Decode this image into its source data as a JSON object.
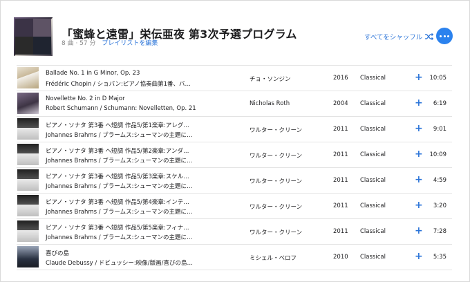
{
  "playlist": {
    "title": "「蜜蜂と遠雷」栄伝亜夜 第3次予選プログラム",
    "count": "8 曲 · 57 分",
    "edit_label": "プレイリストを編集",
    "shuffle_label": "すべてをシャッフル",
    "accent_color": "#2b74d8"
  },
  "tracks": [
    {
      "title": "Ballade No. 1 in G Minor, Op. 23",
      "sub": "Frédéric Chopin / ショパン:ピアノ協奏曲第1番、バ…",
      "artist": "チョ・ソンジン",
      "year": "2016",
      "genre": "Classical",
      "duration": "10:05"
    },
    {
      "title": "Novellette No. 2 in D Major",
      "sub": "Robert Schumann / Schumann: Novelletten, Op. 21",
      "artist": "Nicholas Roth",
      "year": "2004",
      "genre": "Classical",
      "duration": "6:19"
    },
    {
      "title": "ピアノ・ソナタ 第3番 ヘ短調 作品5/第1楽章:アレグ…",
      "sub": "Johannes Brahms / ブラームス:シューマンの主題に…",
      "artist": "ワルター・クリーン",
      "year": "2011",
      "genre": "Classical",
      "duration": "9:01"
    },
    {
      "title": "ピアノ・ソナタ 第3番 ヘ短調 作品5/第2楽章:アンダ…",
      "sub": "Johannes Brahms / ブラームス:シューマンの主題に…",
      "artist": "ワルター・クリーン",
      "year": "2011",
      "genre": "Classical",
      "duration": "10:09"
    },
    {
      "title": "ピアノ・ソナタ 第3番 ヘ短調 作品5/第3楽章:スケル…",
      "sub": "Johannes Brahms / ブラームス:シューマンの主題に…",
      "artist": "ワルター・クリーン",
      "year": "2011",
      "genre": "Classical",
      "duration": "4:59"
    },
    {
      "title": "ピアノ・ソナタ 第3番 ヘ短調 作品5/第4楽章:インテ…",
      "sub": "Johannes Brahms / ブラームス:シューマンの主題に…",
      "artist": "ワルター・クリーン",
      "year": "2011",
      "genre": "Classical",
      "duration": "3:20"
    },
    {
      "title": "ピアノ・ソナタ 第3番 ヘ短調 作品5/第5楽章:フィナ…",
      "sub": "Johannes Brahms / ブラームス:シューマンの主題に…",
      "artist": "ワルター・クリーン",
      "year": "2011",
      "genre": "Classical",
      "duration": "7:28"
    },
    {
      "title": "喜びの島",
      "sub": "Claude Debussy / ドビュッシー:映像/版画/喜びの島…",
      "artist": "ミシェル・ベロフ",
      "year": "2010",
      "genre": "Classical",
      "duration": "5:35"
    }
  ]
}
